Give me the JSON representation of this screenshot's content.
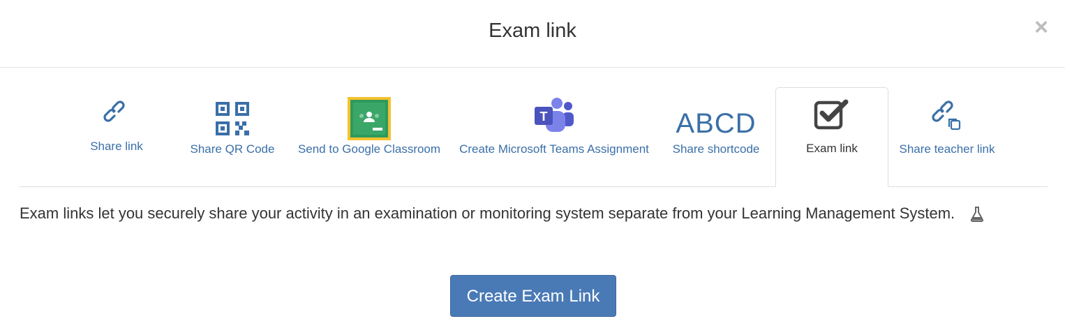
{
  "dialog": {
    "title": "Exam link",
    "close_glyph": "×"
  },
  "tabs": [
    {
      "label": "Share link",
      "icon": "link-icon"
    },
    {
      "label": "Share QR Code",
      "icon": "qr-code-icon"
    },
    {
      "label": "Send to Google Classroom",
      "icon": "google-classroom-icon"
    },
    {
      "label": "Create Microsoft Teams Assignment",
      "icon": "microsoft-teams-icon"
    },
    {
      "label": "Share shortcode",
      "icon_text": "ABCD"
    },
    {
      "label": "Exam link",
      "icon": "checkbox-icon",
      "active": true
    },
    {
      "label": "Share teacher link",
      "icon": "teacher-link-icon"
    }
  ],
  "content": {
    "description": "Exam links let you securely share your activity in an examination or monitoring system separate from your Learning Management System.",
    "beta_icon": "flask-icon",
    "button_label": "Create Exam Link"
  },
  "colors": {
    "link": "#3a6fa8",
    "button": "#4a7ab6",
    "text": "#333333"
  }
}
